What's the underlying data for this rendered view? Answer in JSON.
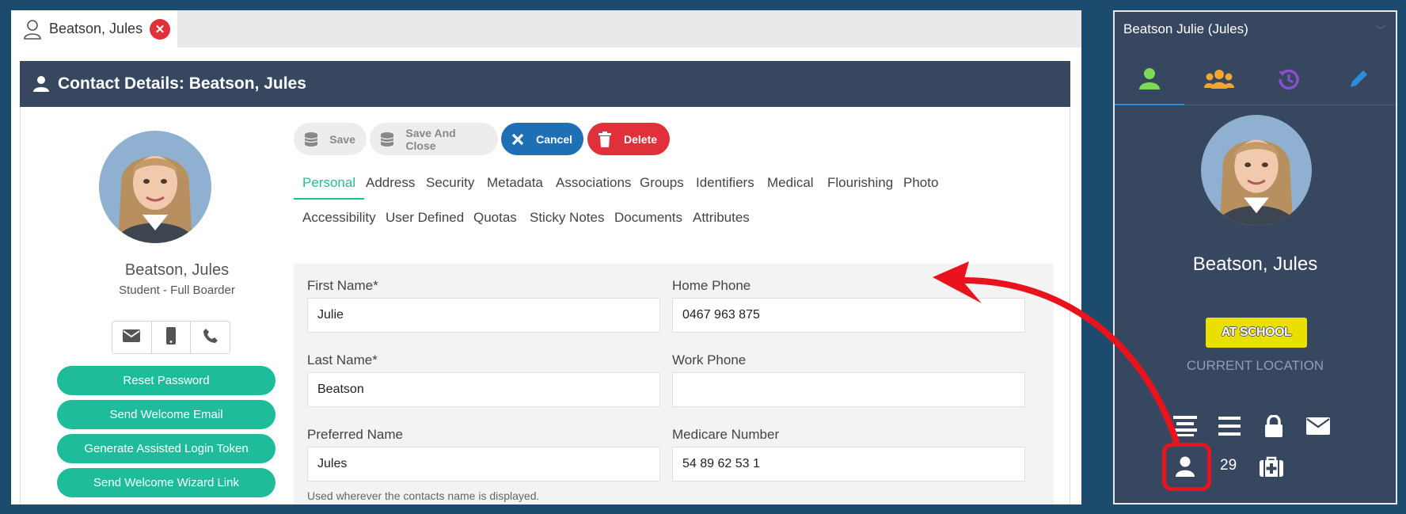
{
  "doc_tab": {
    "label": "Beatson, Jules",
    "close_icon": "close-icon"
  },
  "panel": {
    "title": "Contact Details: Beatson, Jules"
  },
  "profile": {
    "name": "Beatson, Jules",
    "role": "Student - Full Boarder",
    "contact_icons": [
      "email-icon",
      "mobile-icon",
      "phone-icon"
    ],
    "buttons": [
      "Reset Password",
      "Send Welcome Email",
      "Generate Assisted Login Token",
      "Send Welcome Wizard Link"
    ]
  },
  "toolbar": {
    "save": "Save",
    "save_close": "Save And Close",
    "cancel": "Cancel",
    "delete": "Delete"
  },
  "tabs": {
    "row1": [
      "Personal",
      "Address",
      "Security",
      "Metadata",
      "Associations",
      "Groups",
      "Identifiers",
      "Medical",
      "Flourishing",
      "Photo"
    ],
    "row2": [
      "Accessibility",
      "User Defined",
      "Quotas",
      "Sticky Notes",
      "Documents",
      "Attributes"
    ],
    "active": "Personal"
  },
  "form": {
    "first_name_label": "First Name*",
    "first_name": "Julie",
    "last_name_label": "Last Name*",
    "last_name": "Beatson",
    "preferred_name_label": "Preferred Name",
    "preferred_name": "Jules",
    "preferred_hint": "Used wherever the contacts name is displayed.",
    "home_phone_label": "Home Phone",
    "home_phone": "0467 963 875",
    "work_phone_label": "Work Phone",
    "work_phone": "",
    "medicare_label": "Medicare Number",
    "medicare": "54 89 62 53 1"
  },
  "sidebar": {
    "title": "Beatson Julie (Jules)",
    "tabs": [
      "user-icon",
      "group-icon",
      "history-icon",
      "edit-icon"
    ],
    "name": "Beatson, Jules",
    "badge": "AT SCHOOL",
    "location_label": "CURRENT LOCATION",
    "count": "29",
    "row1_icons": [
      "list-alt-icon",
      "list-icon",
      "lock-icon",
      "envelope-icon"
    ],
    "row2_icons": [
      "user-icon",
      "medical-kit-icon"
    ]
  },
  "colors": {
    "background": "#1c4b6e",
    "header": "#36475f",
    "accent_green": "#1ebc9a",
    "cancel_blue": "#1f6fb4",
    "delete_red": "#e0303a",
    "badge_yellow": "#eae000",
    "annotation_red": "#e8131c"
  }
}
